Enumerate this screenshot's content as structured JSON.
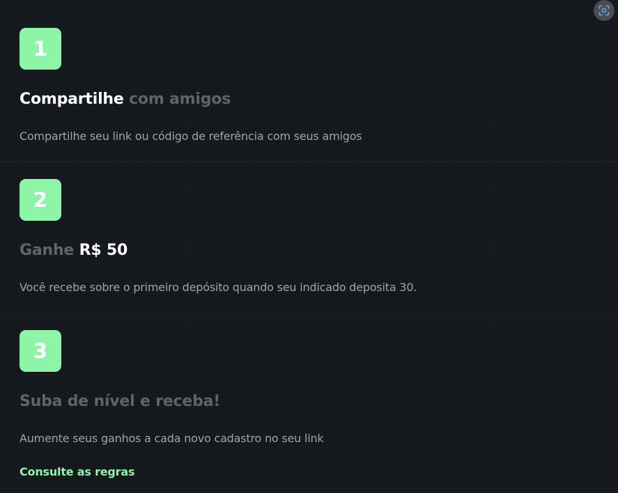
{
  "steps": [
    {
      "number": "1",
      "title_strong": "Compartilhe",
      "title_muted": "com amigos",
      "description": "Compartilhe seu link ou código de referência com seus amigos"
    },
    {
      "number": "2",
      "title_muted": "Ganhe",
      "title_strong": "R$ 50",
      "description": "Você recebe sobre o primeiro depósito quando seu indicado deposita 30."
    },
    {
      "number": "3",
      "title_muted": "Suba de nível e receba!",
      "description": "Aumente seus ganhos a cada novo cadastro no seu link",
      "link": "Consulte as regras"
    }
  ],
  "colors": {
    "accent": "#8ef5a8",
    "background": "#14171c",
    "title_muted": "#5f636a",
    "description": "#a1a5ab"
  },
  "icons": {
    "top_right": "screen-scan-icon"
  }
}
